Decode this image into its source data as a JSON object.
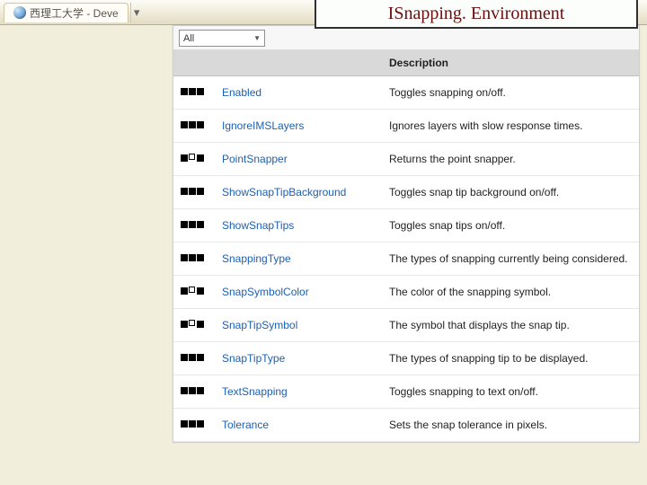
{
  "browser": {
    "tabs": [
      {
        "label": "西理工大学 - Deve"
      }
    ]
  },
  "banner": {
    "title": "ISnapping. Environment"
  },
  "doc": {
    "filter": {
      "selected": "All"
    },
    "headers": {
      "name": "",
      "description": "Description"
    },
    "members": [
      {
        "icon": "rw",
        "name": "Enabled",
        "desc": "Toggles snapping on/off."
      },
      {
        "icon": "rw",
        "name": "IgnoreIMSLayers",
        "desc": "Ignores layers with slow response times."
      },
      {
        "icon": "ro",
        "name": "PointSnapper",
        "desc": "Returns the point snapper."
      },
      {
        "icon": "rw",
        "name": "ShowSnapTipBackground",
        "desc": "Toggles snap tip background on/off."
      },
      {
        "icon": "rw",
        "name": "ShowSnapTips",
        "desc": "Toggles snap tips on/off."
      },
      {
        "icon": "rw",
        "name": "SnappingType",
        "desc": "The types of snapping currently being considered."
      },
      {
        "icon": "ro",
        "name": "SnapSymbolColor",
        "desc": "The color of the snapping symbol."
      },
      {
        "icon": "ro",
        "name": "SnapTipSymbol",
        "desc": "The symbol that displays the snap tip."
      },
      {
        "icon": "rw",
        "name": "SnapTipType",
        "desc": "The types of snapping tip to be displayed."
      },
      {
        "icon": "rw",
        "name": "TextSnapping",
        "desc": "Toggles snapping to text on/off."
      },
      {
        "icon": "rw",
        "name": "Tolerance",
        "desc": "Sets the snap tolerance in pixels."
      }
    ]
  }
}
